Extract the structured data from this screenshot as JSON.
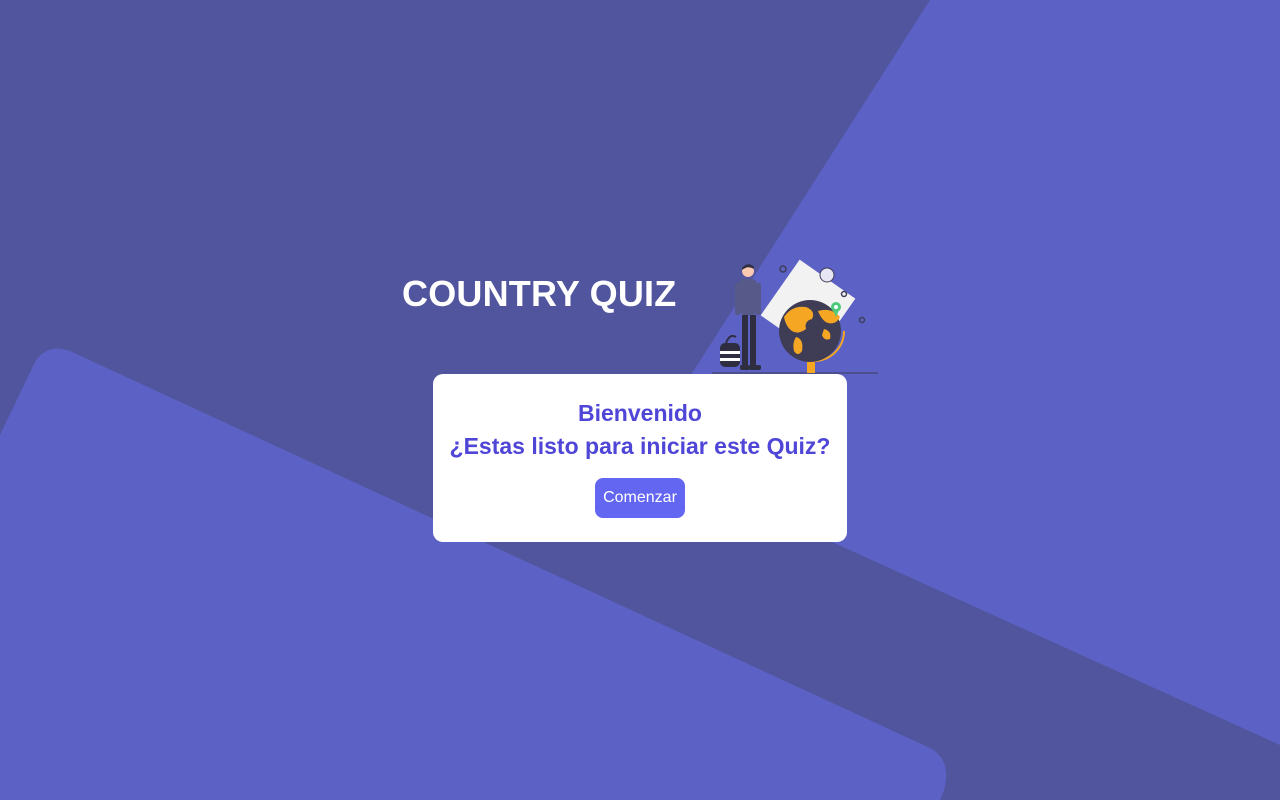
{
  "header": {
    "title": "COUNTRY QUIZ",
    "illustration_icon": "traveler-with-globe-icon"
  },
  "card": {
    "welcome_line1": "Bienvenido",
    "welcome_line2": "¿Estas listo para iniciar este Quiz?",
    "start_button_label": "Comenzar"
  },
  "colors": {
    "background": "#51559e",
    "background_shape": "#5c62c5",
    "card": "#ffffff",
    "heading_text": "#4f46d8",
    "button": "#6366f1",
    "title_text": "#ffffff",
    "globe_land": "#f5a623",
    "globe_ocean": "#3f3d56"
  }
}
